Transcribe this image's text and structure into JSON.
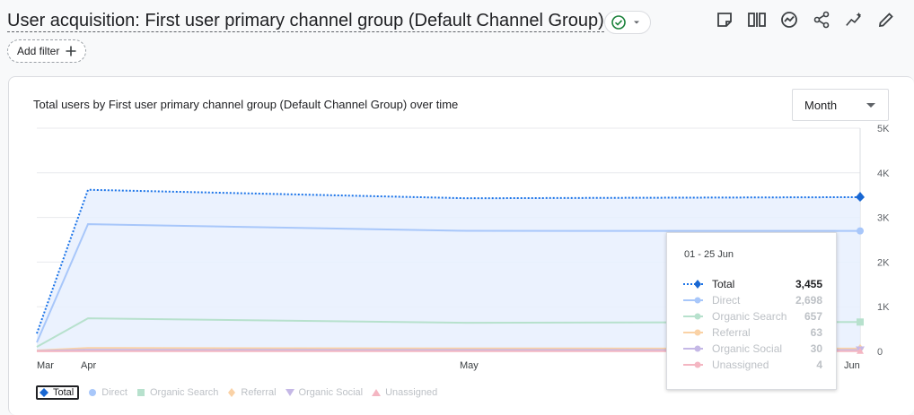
{
  "header": {
    "title": "User acquisition: First user primary channel group (Default Channel Group)",
    "add_filter_label": "Add filter",
    "toolbar_icons": [
      "notes-icon",
      "compare-icon",
      "insights-icon",
      "share-icon",
      "trend-icon",
      "edit-icon"
    ]
  },
  "card": {
    "title": "Total users by First user primary channel group (Default Channel Group) over time",
    "period": "Month"
  },
  "colors": {
    "total": "#1a73e8",
    "total_marker": "#1967d2",
    "direct": "#a8c7fa",
    "organic_search": "#b7e1cd",
    "referral": "#fad2a6",
    "organic_social": "#c5b8e6",
    "unassigned": "#f4b6c2",
    "fill": "#e8f0fe"
  },
  "chart_data": {
    "type": "line",
    "categories": [
      "Mar",
      "Apr",
      "May",
      "Jun"
    ],
    "y_ticks": [
      "0",
      "1K",
      "2K",
      "3K",
      "4K",
      "5K"
    ],
    "ylim": [
      0,
      5000
    ],
    "legend_position": "bottom-left",
    "series": [
      {
        "name": "Total",
        "values": [
          400,
          3620,
          3430,
          3455
        ]
      },
      {
        "name": "Direct",
        "values": [
          200,
          2850,
          2700,
          2698
        ]
      },
      {
        "name": "Organic Search",
        "values": [
          100,
          740,
          640,
          657
        ]
      },
      {
        "name": "Referral",
        "values": [
          20,
          75,
          65,
          63
        ]
      },
      {
        "name": "Organic Social",
        "values": [
          10,
          35,
          32,
          30
        ]
      },
      {
        "name": "Unassigned",
        "values": [
          2,
          5,
          4,
          4
        ]
      }
    ]
  },
  "tooltip": {
    "date": "01 - 25 Jun",
    "rows": [
      {
        "label": "Total",
        "value": "3,455"
      },
      {
        "label": "Direct",
        "value": "2,698"
      },
      {
        "label": "Organic Search",
        "value": "657"
      },
      {
        "label": "Referral",
        "value": "63"
      },
      {
        "label": "Organic Social",
        "value": "30"
      },
      {
        "label": "Unassigned",
        "value": "4"
      }
    ]
  },
  "legend": [
    "Total",
    "Direct",
    "Organic Search",
    "Referral",
    "Organic Social",
    "Unassigned"
  ]
}
